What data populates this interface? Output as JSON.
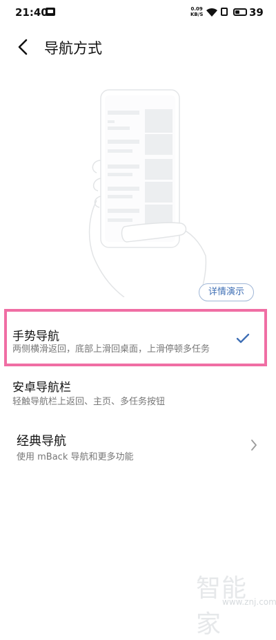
{
  "status": {
    "time": "21:40",
    "speed_value": "0.09",
    "speed_unit": "KB/S",
    "battery": "39"
  },
  "header": {
    "title": "导航方式"
  },
  "illustration": {
    "demo_button_label": "详情演示"
  },
  "options": [
    {
      "title": "手势导航",
      "description": "两侧横滑返回，底部上滑回桌面，上滑停顿多任务",
      "selected": true
    },
    {
      "title": "安卓导航栏",
      "description": "轻触导航栏上返回、主页、多任务按钮",
      "selected": false
    },
    {
      "title": "经典导航",
      "description": "使用 mBack 导航和更多功能",
      "selected": false
    }
  ],
  "watermark": {
    "text": "智能家",
    "url": "www.znj.com"
  },
  "colors": {
    "accent": "#3f6fb5",
    "highlight_border": "#f06ea4"
  }
}
